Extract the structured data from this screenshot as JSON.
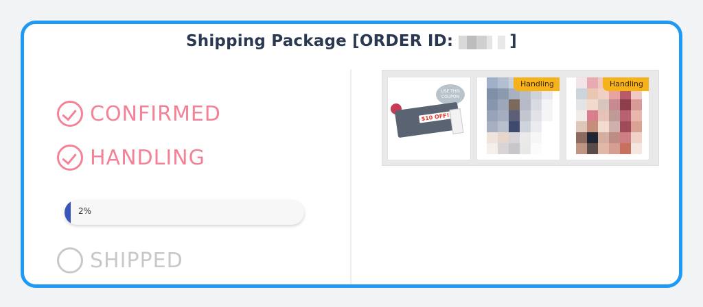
{
  "modal": {
    "title_prefix": "Shipping Package [ORDER ID:",
    "title_suffix": "]"
  },
  "steps": [
    {
      "label": "CONFIRMED",
      "status": "done",
      "icon": "check-circle-icon"
    },
    {
      "label": "HANDLING",
      "status": "done",
      "icon": "check-circle-icon"
    },
    {
      "label": "SHIPPED",
      "status": "pending",
      "icon": "empty-circle-icon"
    }
  ],
  "progress": {
    "label": "2%",
    "value": 0.02,
    "color": "#3a55b9"
  },
  "items": [
    {
      "type": "coupon",
      "bubble_text": "USE THIS COUPON",
      "amount_text": "$10 OFF!!"
    },
    {
      "type": "product",
      "badge": "Handling"
    },
    {
      "type": "product",
      "badge": "Handling"
    }
  ],
  "colors": {
    "accent_border": "#1e9af5",
    "done": "#f48296",
    "pending": "#c8c8c8",
    "badge": "#f6b21b"
  }
}
